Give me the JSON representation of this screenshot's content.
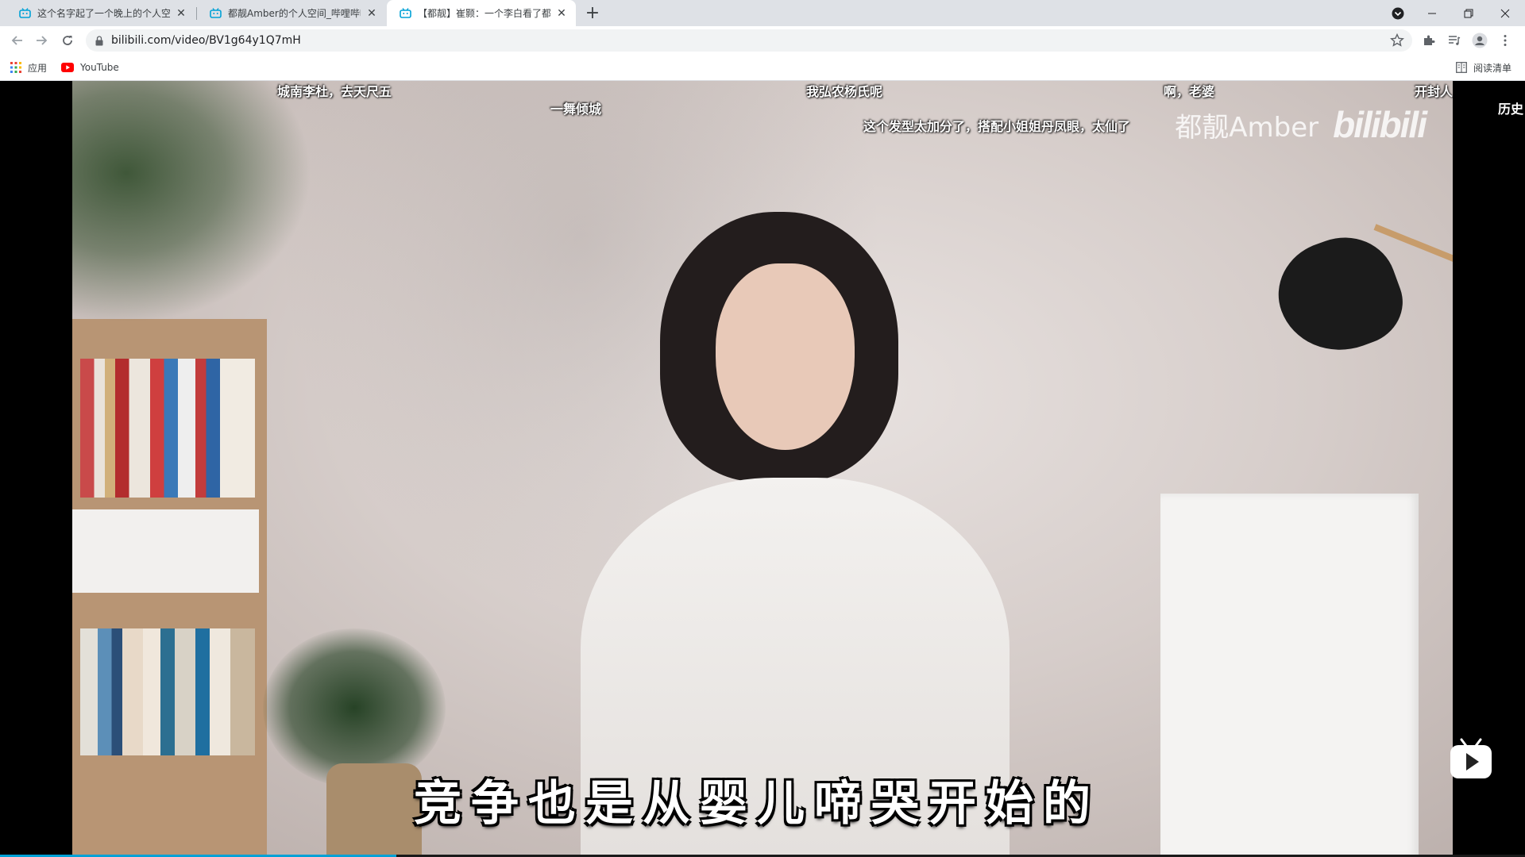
{
  "browser": {
    "tabs": [
      {
        "title": "这个名字起了一个晚上的个人空间",
        "active": false
      },
      {
        "title": "都靓Amber的个人空间_哔哩哔哩",
        "active": false
      },
      {
        "title": "【都靓】崔颢：一个李白看了都心",
        "active": true
      }
    ],
    "new_tab_label": "+",
    "url": "bilibili.com/video/BV1g64y1Q7mH",
    "bookmarks": [
      {
        "label": "应用",
        "icon": "apps-grid-icon"
      },
      {
        "label": "YouTube",
        "icon": "youtube-icon"
      }
    ],
    "reading_list_label": "阅读清单"
  },
  "video": {
    "danmaku": [
      "城南李杜，去天尺五",
      "一舞倾城",
      "我弘农杨氏呢",
      "啊，老婆",
      "开封人",
      "这个发型太加分了，搭配小姐姐丹凤眼，太仙了",
      "历史"
    ],
    "subtitle": "竞争也是从婴儿啼哭开始的",
    "watermark_name": "都靓Amber",
    "watermark_logo": "bilibili",
    "progress": 0.26
  },
  "colors": {
    "accent": "#00a1d6",
    "tab_bg": "#dee1e6",
    "youtube_red": "#ff0000"
  }
}
